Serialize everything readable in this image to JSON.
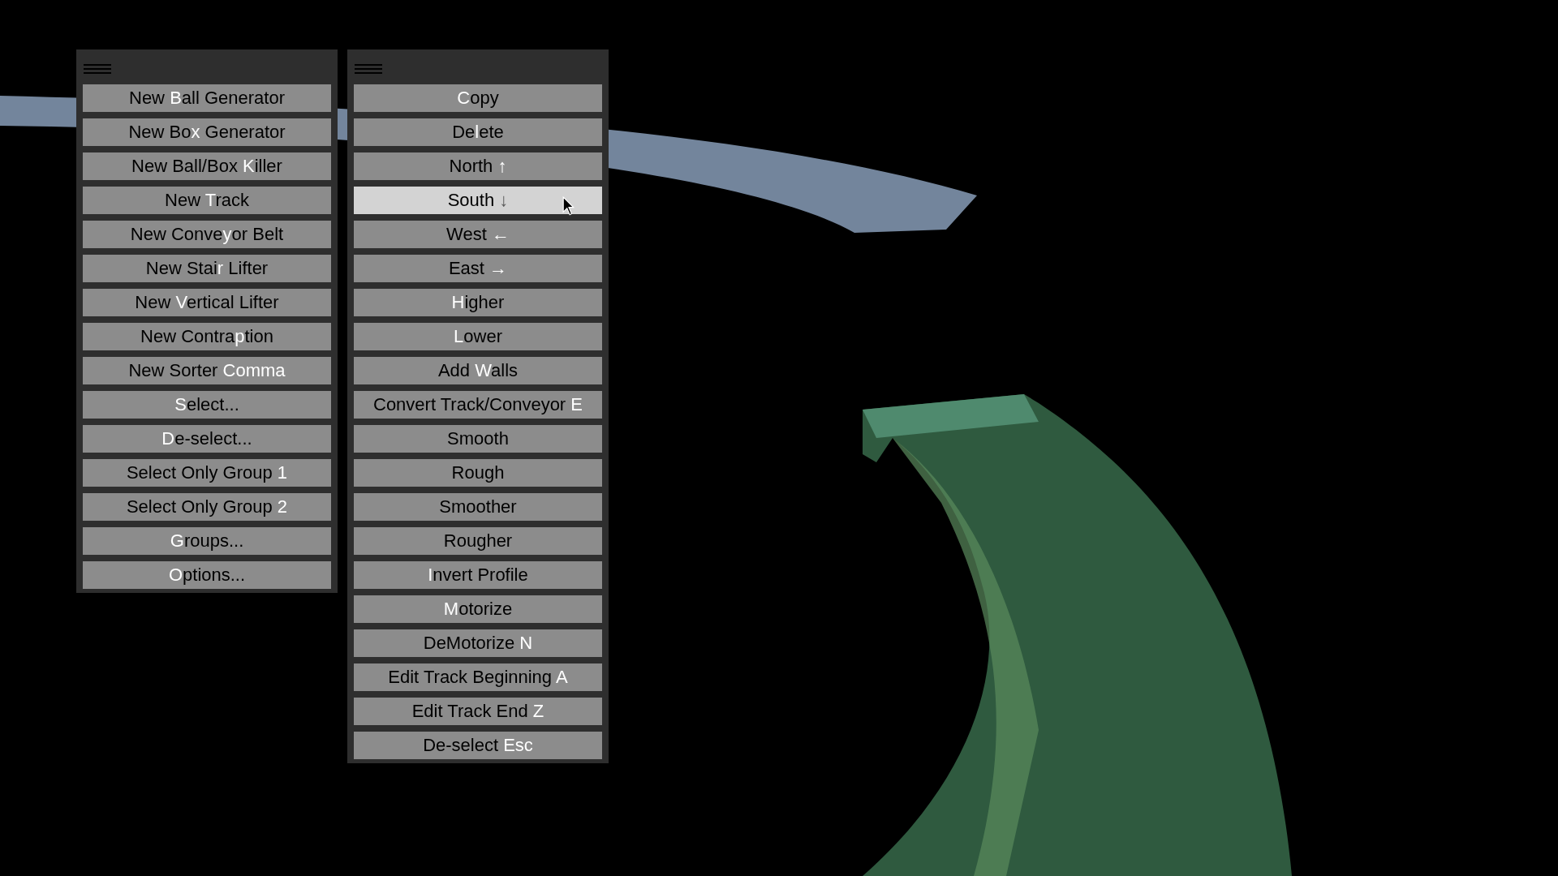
{
  "menus": [
    {
      "items": [
        {
          "pre": "New ",
          "key": "B",
          "post": "all Generator",
          "hovered": false
        },
        {
          "pre": "New Bo",
          "key": "x",
          "post": " Generator",
          "hovered": false
        },
        {
          "pre": "New Ball/Box ",
          "key": "K",
          "post": "iller",
          "hovered": false
        },
        {
          "pre": "New ",
          "key": "T",
          "post": "rack",
          "hovered": false
        },
        {
          "pre": "New Conve",
          "key": "y",
          "post": "or Belt",
          "hovered": false
        },
        {
          "pre": "New Stai",
          "key": "r",
          "post": " Lifter",
          "hovered": false
        },
        {
          "pre": "New ",
          "key": "V",
          "post": "ertical Lifter",
          "hovered": false
        },
        {
          "pre": "New Contra",
          "key": "p",
          "post": "tion",
          "hovered": false
        },
        {
          "pre": "New Sorter ",
          "key": "Comma",
          "hovered": false
        },
        {
          "key": "S",
          "post": "elect...",
          "hovered": false
        },
        {
          "key": "D",
          "post": "e-select...",
          "hovered": false
        },
        {
          "pre": "Select Only Group ",
          "key": "1",
          "hovered": false
        },
        {
          "pre": "Select Only Group ",
          "key": "2",
          "hovered": false
        },
        {
          "key": "G",
          "post": "roups...",
          "hovered": false
        },
        {
          "key": "O",
          "post": "ptions...",
          "hovered": false
        }
      ]
    },
    {
      "items": [
        {
          "key": "C",
          "post": "opy",
          "hovered": false
        },
        {
          "pre": "De",
          "key": "l",
          "post": "ete",
          "hovered": false
        },
        {
          "pre": "North ",
          "key": "↑",
          "hovered": false
        },
        {
          "pre": "South ",
          "key": "↓",
          "hovered": true
        },
        {
          "pre": "West ",
          "key": "←",
          "hovered": false
        },
        {
          "pre": "East ",
          "key": "→",
          "hovered": false
        },
        {
          "key": "H",
          "post": "igher",
          "hovered": false
        },
        {
          "key": "L",
          "post": "ower",
          "hovered": false
        },
        {
          "pre": "Add ",
          "key": "W",
          "post": "alls",
          "hovered": false
        },
        {
          "pre": "Convert Track/Conveyor ",
          "key": "E",
          "hovered": false
        },
        {
          "pre": "Smooth",
          "hovered": false
        },
        {
          "pre": "Rough",
          "hovered": false
        },
        {
          "pre": "Smoother",
          "hovered": false
        },
        {
          "pre": "Rougher",
          "hovered": false
        },
        {
          "key": "I",
          "post": "nvert Profile",
          "hovered": false
        },
        {
          "key": "M",
          "post": "otorize",
          "hovered": false
        },
        {
          "pre": "DeMotorize ",
          "key": "N",
          "hovered": false
        },
        {
          "pre": "Edit Track Beginning ",
          "key": "A",
          "hovered": false
        },
        {
          "pre": "Edit Track End ",
          "key": "Z",
          "hovered": false
        },
        {
          "pre": "De-select ",
          "key": "Esc",
          "hovered": false
        }
      ]
    }
  ]
}
